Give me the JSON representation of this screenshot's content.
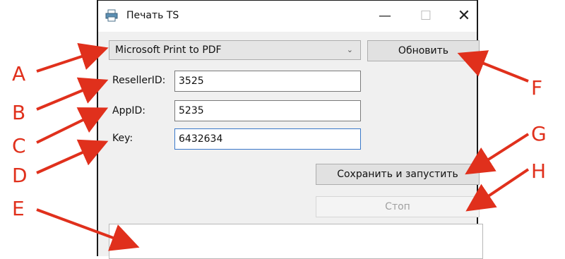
{
  "window": {
    "title": "Печать TS",
    "minimize_glyph": "—",
    "maximize_glyph": "☐",
    "close_glyph": "✕"
  },
  "printer_select": {
    "value": "Microsoft Print to PDF",
    "chevron": "⌄"
  },
  "refresh_button": {
    "label": "Обновить"
  },
  "fields": {
    "reseller_label": "ResellerID:",
    "reseller_value": "3525",
    "app_label": "AppID:",
    "app_value": "5235",
    "key_label": "Key:",
    "key_value": "6432634"
  },
  "save_run_button": {
    "label": "Сохранить и запустить"
  },
  "stop_button": {
    "label": "Стоп",
    "enabled": false
  },
  "annotations": {
    "A": "A",
    "B": "B",
    "C": "C",
    "D": "D",
    "E": "E",
    "F": "F",
    "G": "G",
    "H": "H"
  },
  "colors": {
    "annotation": "#e0301c",
    "focus_border": "#3a78c9"
  }
}
